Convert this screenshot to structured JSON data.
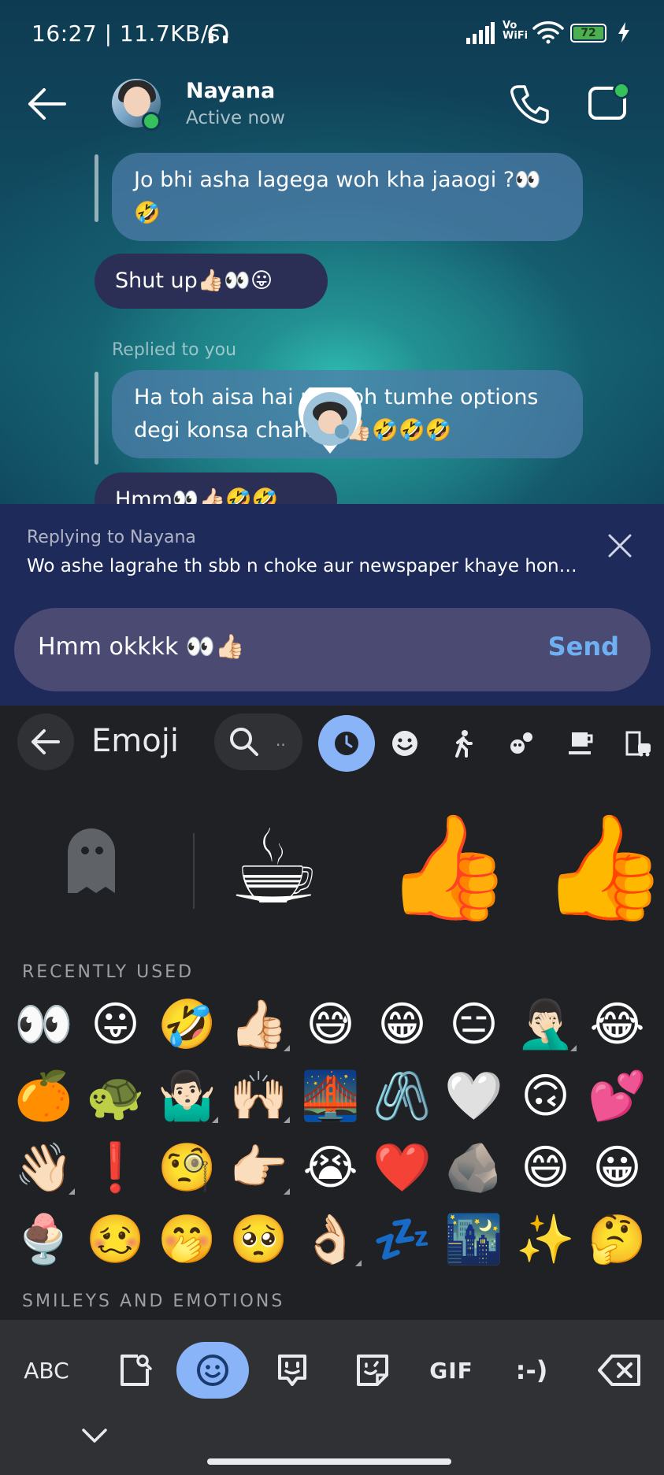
{
  "status_bar": {
    "time_speed": "16:27 | 11.7KB/s",
    "vowifi_top": "Vo",
    "vowifi_bottom": "WiFi",
    "battery": "72"
  },
  "header": {
    "contact_name": "Nayana",
    "contact_status": "Active now"
  },
  "messages": [
    {
      "text": "Jo bhi asha lagega woh kha jaaogi ?👀 🤣",
      "style": "quoted-reply"
    },
    {
      "text": "Shut up👍🏻👀😛",
      "style": "incoming"
    },
    {
      "text": "Ha toh aisa hai na woh tumhe options degi konsa chahiye 👍🏻🤣🤣🤣",
      "style": "quoted-reply",
      "label": "Replied to you"
    },
    {
      "text": "Hmm👀👍🏻🤣🤣",
      "style": "incoming-partial"
    }
  ],
  "reply": {
    "replying_to": "Replying to Nayana",
    "preview": "Wo ashe lagrahe th sbb n choke aur newspaper khaye hong…"
  },
  "composer": {
    "text": "Hmm okkkk 👀👍🏻",
    "send_label": "Send"
  },
  "keyboard": {
    "title": "Emoji",
    "search_placeholder": "..",
    "categories": [
      "recent-icon",
      "smiley-icon",
      "person-walking-icon",
      "animals-nature-icon",
      "food-drink-icon",
      "travel-places-icon"
    ],
    "stickers": [
      "☕",
      "👍",
      "👍"
    ],
    "recently_used_title": "RECENTLY USED",
    "recently_used": [
      {
        "e": "👀"
      },
      {
        "e": "😛"
      },
      {
        "e": "🤣"
      },
      {
        "e": "👍🏻",
        "variant": true
      },
      {
        "e": "😅"
      },
      {
        "e": "😁"
      },
      {
        "e": "😑"
      },
      {
        "e": "🤦🏻‍♂️",
        "variant": true
      },
      {
        "e": "😂"
      },
      {
        "e": "🍊"
      },
      {
        "e": "🐢"
      },
      {
        "e": "🤷🏻‍♂️",
        "variant": true
      },
      {
        "e": "🙌🏻",
        "variant": true
      },
      {
        "e": "🌉"
      },
      {
        "e": "🖇️"
      },
      {
        "e": "🤍"
      },
      {
        "e": "🙃"
      },
      {
        "e": "💕"
      },
      {
        "e": "👋🏻",
        "variant": true
      },
      {
        "e": "❗"
      },
      {
        "e": "🧐"
      },
      {
        "e": "👉🏻",
        "variant": true
      },
      {
        "e": "😭"
      },
      {
        "e": "❤️"
      },
      {
        "e": "🪨"
      },
      {
        "e": "😄"
      },
      {
        "e": "😀"
      },
      {
        "e": "🍨"
      },
      {
        "e": "🥴"
      },
      {
        "e": "🤭"
      },
      {
        "e": "🥺"
      },
      {
        "e": "👌🏻",
        "variant": true
      },
      {
        "e": "💤"
      },
      {
        "e": "🌃"
      },
      {
        "e": "✨"
      },
      {
        "e": "🤔"
      }
    ],
    "smileys_title": "SMILEYS AND EMOTIONS",
    "bottom": {
      "abc": "ABC",
      "gif": "GIF",
      "kaomoji": ":-)"
    }
  }
}
